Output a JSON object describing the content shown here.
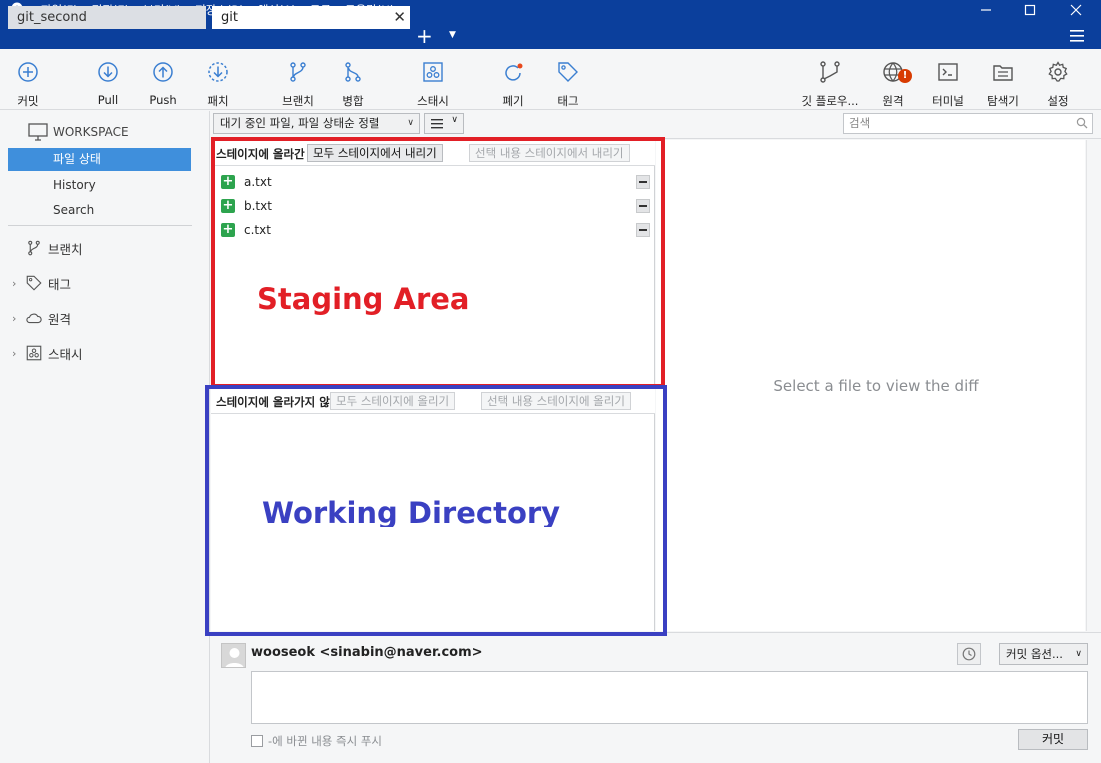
{
  "menu": [
    "파일(F)",
    "편집(E)",
    "보기(V)",
    "저장소(R)",
    "액션(A)",
    "도구",
    "도움말(H)"
  ],
  "tabs": {
    "inactive": "git_second",
    "active": "git"
  },
  "toolbar": {
    "commit": "커밋",
    "pull": "Pull",
    "push": "Push",
    "fetch": "패치",
    "branch": "브랜치",
    "merge": "병합",
    "stash": "스태시",
    "discard": "폐기",
    "tag": "태그",
    "git_flow": "깃 플로우...",
    "remote": "원격",
    "remote_badge": "!",
    "terminal": "터미널",
    "explorer": "탐색기",
    "settings": "설정"
  },
  "sidebar": {
    "workspace": "WORKSPACE",
    "items": [
      "파일 상태",
      "History",
      "Search"
    ],
    "sections": [
      "브랜치",
      "태그",
      "원격",
      "스태시"
    ]
  },
  "filter": {
    "sort_label": "대기 중인 파일, 파일 상태순 정렬",
    "search_placeholder": "검색"
  },
  "staged": {
    "title": "스테이지에 올라간 파일",
    "unstage_all": "모두 스테이지에서 내리기",
    "unstage_selected": "선택 내용 스테이지에서 내리기",
    "files": [
      "a.txt",
      "b.txt",
      "c.txt"
    ]
  },
  "unstaged": {
    "title": "스테이지에 올라가지 않은 파일",
    "stage_all": "모두 스테이지에 올리기",
    "stage_selected": "선택 내용 스테이지에 올리기"
  },
  "diff": {
    "empty_message": "Select a file to view the diff"
  },
  "commit": {
    "author": "wooseok <sinabin@naver.com>",
    "options": "커밋 옵션...",
    "push_now": "-에 바뀐 내용 즉시 푸시",
    "commit_button": "커밋"
  },
  "annotations": {
    "staging": "Staging Area",
    "working": "Working Directory"
  },
  "colors": {
    "titlebar": "#0b3f9c",
    "selection": "#3f8fdc",
    "icon_blue": "#3b7fd1",
    "annotation_red": "#e21f26",
    "annotation_blue": "#3a40c2",
    "added_green": "#2da44e"
  }
}
